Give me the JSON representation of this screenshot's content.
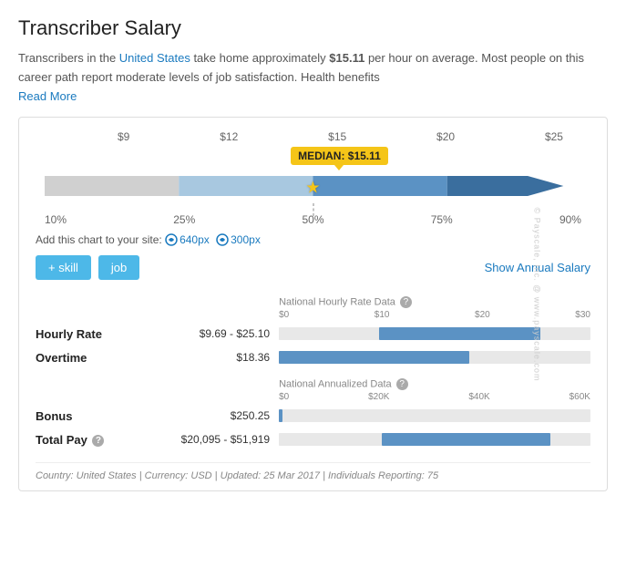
{
  "page": {
    "title": "Transcriber Salary",
    "intro": "Transcribers in the ",
    "country_link": "United States",
    "intro2": " take home approximately ",
    "salary_highlight": "$15.11",
    "intro3": " per hour on average. Most people on this career path report moderate levels of job satisfaction. Health benefits",
    "read_more": "Read More"
  },
  "chart": {
    "axis_top": [
      "$9",
      "$12",
      "$15",
      "$20",
      "$25"
    ],
    "median_label": "MEDIAN: $15.11",
    "axis_bottom": [
      "10%",
      "25%",
      "50%",
      "75%",
      "90%"
    ],
    "add_chart_text": "Add this chart to your site:",
    "link_640": "640px",
    "link_300": "300px"
  },
  "buttons": {
    "skill": "+ skill",
    "job": "job",
    "show_annual": "Show Annual Salary"
  },
  "hourly_section": {
    "header": "National Hourly Rate Data (?)",
    "axis_labels": [
      "$0",
      "$10",
      "$20",
      "$30"
    ],
    "rows": [
      {
        "label": "Hourly Rate",
        "value": "$9.69 - $25.10",
        "bar_start_pct": 32,
        "bar_end_pct": 84,
        "type": "range"
      },
      {
        "label": "Overtime",
        "value": "$18.36",
        "bar_start_pct": 0,
        "bar_end_pct": 61,
        "type": "single"
      }
    ]
  },
  "annual_section": {
    "header": "National Annualized Data (?)",
    "axis_labels": [
      "$0",
      "$20K",
      "$40K",
      "$60K"
    ],
    "rows": [
      {
        "label": "Bonus",
        "value": "$250.25",
        "bar_start_pct": 0,
        "bar_end_pct": 4,
        "type": "single"
      },
      {
        "label": "Total Pay (?)",
        "value": "$20,095 - $51,919",
        "bar_start_pct": 33,
        "bar_end_pct": 87,
        "type": "range"
      }
    ]
  },
  "footer": "Country: United States  |  Currency: USD  |  Updated: 25 Mar 2017  |  Individuals Reporting: 75",
  "watermark": "© Payscale, Inc. @ www.payscale.com"
}
